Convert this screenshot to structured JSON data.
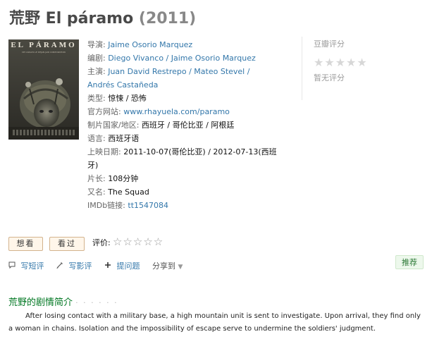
{
  "header": {
    "title": "荒野 El páramo",
    "year": "(2011)"
  },
  "poster": {
    "title": "EL PÁRAMO",
    "subtitle": "DE CARLOS LE DEJAN JAIR CORPORATION"
  },
  "info": {
    "director_label": "导演: ",
    "director": "Jaime Osorio Marquez",
    "writer_label": "编剧: ",
    "writers": "Diego Vivanco / Jaime Osorio Marquez",
    "cast_label": "主演: ",
    "cast": "Juan David Restrepo / Mateo Stevel / Andrés Castañeda",
    "genre_label": "类型: ",
    "genre": "惊悚 / 恐怖",
    "site_label": "官方网站: ",
    "site": "www.rhayuela.com/paramo",
    "country_label": "制片国家/地区: ",
    "country": "西班牙 / 哥伦比亚 / 阿根廷",
    "language_label": "语言: ",
    "language": "西班牙语",
    "release_label": "上映日期: ",
    "release": "2011-10-07(哥伦比亚) / 2012-07-13(西班牙)",
    "runtime_label": "片长: ",
    "runtime": "108分钟",
    "aka_label": "又名: ",
    "aka": "The Squad",
    "imdb_label": "IMDb链接: ",
    "imdb": "tt1547084"
  },
  "rating": {
    "label": "豆瓣评分",
    "stars": "★★★★★",
    "none_text": "暂无评分"
  },
  "user_actions": {
    "want_label": "想看",
    "seen_label": "看过",
    "rate_label": "评价:",
    "rate_stars": "☆☆☆☆☆",
    "short_review": "写短评",
    "review": "写影评",
    "ask": "提问题",
    "share": "分享到",
    "recommend": "推荐"
  },
  "synopsis": {
    "heading": "荒野的剧情简介",
    "dots": "· · · · · ·",
    "text": "After losing contact with a military base, a high mountain unit is sent to investigate. Upon arrival, they find only a woman in chains. Isolation and the impossibility of escape serve to undermine the soldiers' judgment."
  }
}
